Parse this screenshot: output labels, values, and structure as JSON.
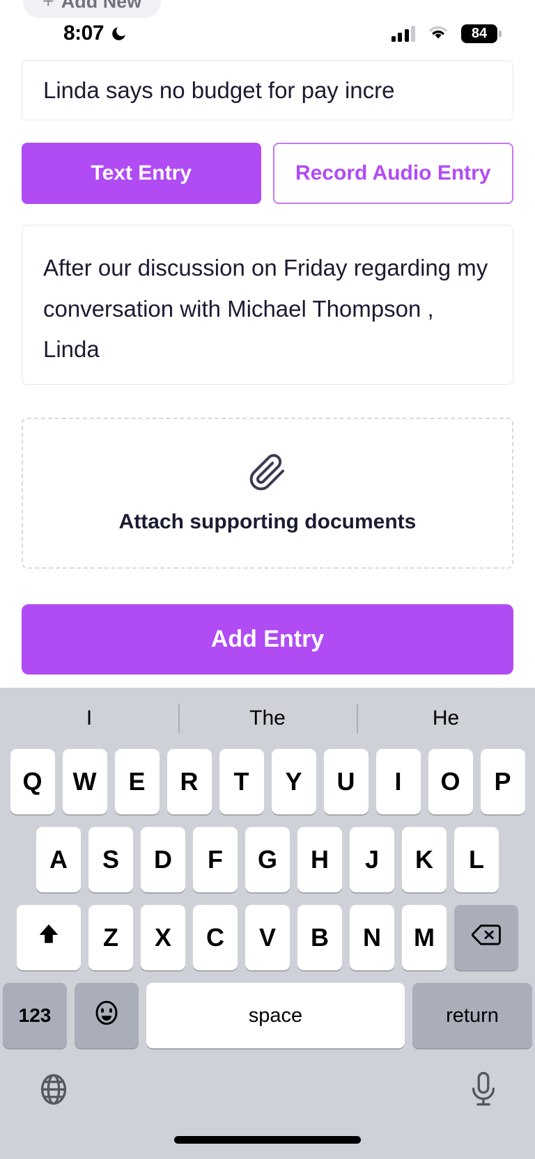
{
  "top_pill": {
    "plus": "+",
    "label": "Add New"
  },
  "status_bar": {
    "time": "8:07",
    "moon_icon": "crescent-moon-icon",
    "signal_icon": "cellular-signal-icon",
    "wifi_icon": "wifi-icon",
    "battery_level": "84"
  },
  "form": {
    "title_value": "Linda says no budget for pay incre",
    "mode_text_label": "Text Entry",
    "mode_audio_label": "Record Audio Entry",
    "note_value": "After our discussion on Friday regarding my conversation with Michael Thompson , Linda",
    "attach_icon": "paperclip-icon",
    "attach_label": "Attach supporting documents",
    "submit_label": "Add Entry"
  },
  "colors": {
    "accent_purple": "#b14bf4",
    "accent_outline": "#c777f6",
    "keyboard_bg": "#ced1d8",
    "key_dark": "#a9aeba",
    "text_dark": "#1b1b32"
  },
  "keyboard": {
    "suggestions": [
      "I",
      "The",
      "He"
    ],
    "row1": [
      "Q",
      "W",
      "E",
      "R",
      "T",
      "Y",
      "U",
      "I",
      "O",
      "P"
    ],
    "row2": [
      "A",
      "S",
      "D",
      "F",
      "G",
      "H",
      "J",
      "K",
      "L"
    ],
    "row3": [
      "Z",
      "X",
      "C",
      "V",
      "B",
      "N",
      "M"
    ],
    "shift_icon": "shift-up-arrow-icon",
    "backspace_icon": "backspace-delete-icon",
    "numbers_label": "123",
    "emoji_icon": "smiley-face-icon",
    "space_label": "space",
    "return_label": "return",
    "globe_icon": "globe-language-icon",
    "mic_icon": "microphone-icon"
  }
}
